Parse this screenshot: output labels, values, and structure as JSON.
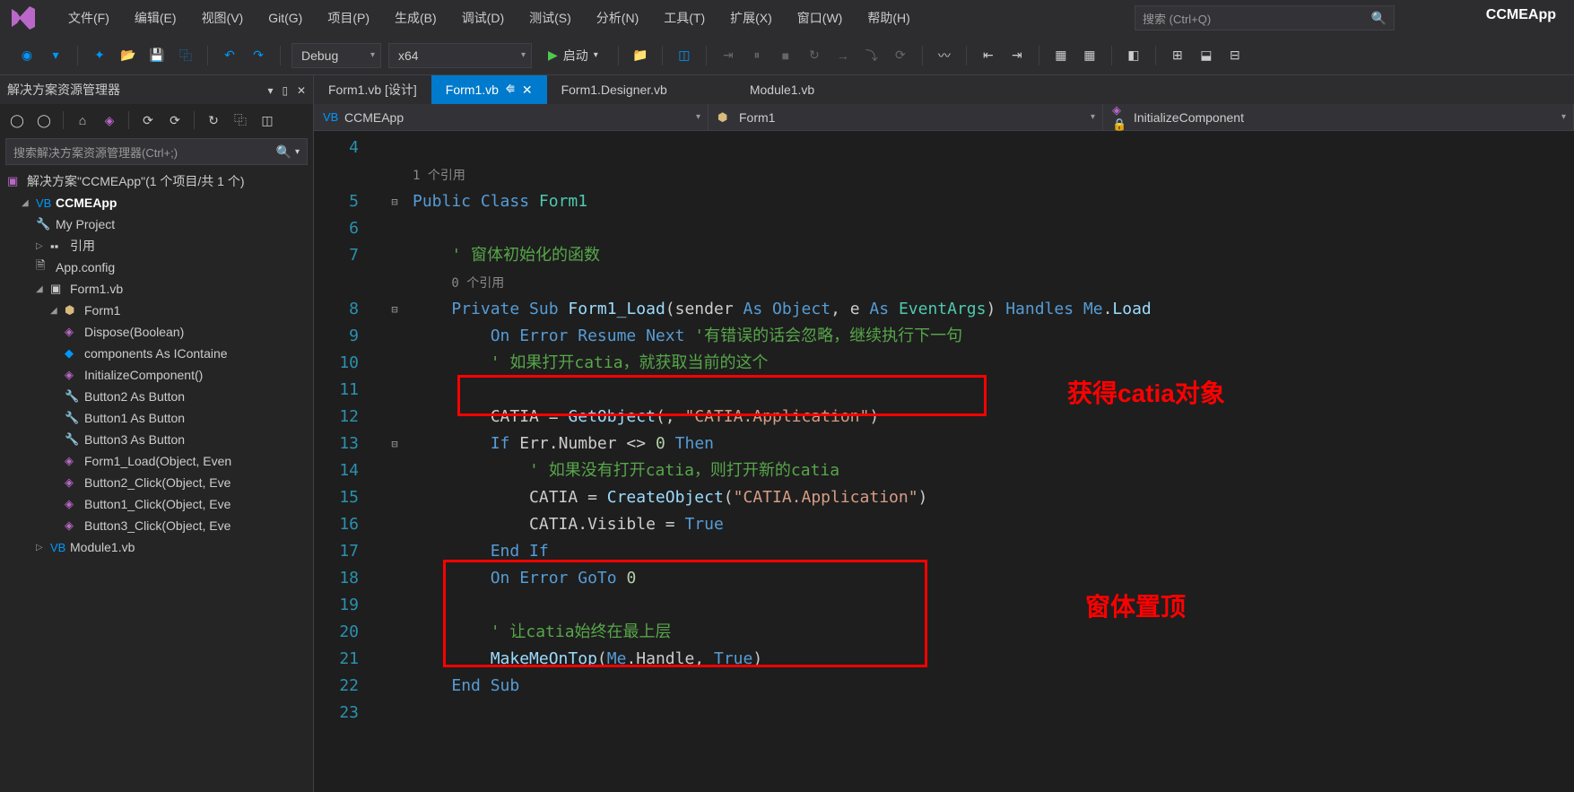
{
  "menu": {
    "items": [
      "文件(F)",
      "编辑(E)",
      "视图(V)",
      "Git(G)",
      "项目(P)",
      "生成(B)",
      "调试(D)",
      "测试(S)",
      "分析(N)",
      "工具(T)",
      "扩展(X)",
      "窗口(W)",
      "帮助(H)"
    ],
    "search_placeholder": "搜索 (Ctrl+Q)",
    "app_name": "CCMEApp"
  },
  "toolbar": {
    "config": "Debug",
    "platform": "x64",
    "start": "启动"
  },
  "solution_explorer": {
    "title": "解决方案资源管理器",
    "search_placeholder": "搜索解决方案资源管理器(Ctrl+;)",
    "root": "解决方案\"CCMEApp\"(1 个项目/共 1 个)",
    "project": "CCMEApp",
    "nodes": {
      "myproject": "My Project",
      "references": "引用",
      "appconfig": "App.config",
      "form1vb": "Form1.vb",
      "form1": "Form1",
      "dispose": "Dispose(Boolean)",
      "components": "components As IContaine",
      "initcomp": "InitializeComponent()",
      "btn2": "Button2 As Button",
      "btn1": "Button1 As Button",
      "btn3": "Button3 As Button",
      "form1load": "Form1_Load(Object, Even",
      "btn2click": "Button2_Click(Object, Eve",
      "btn1click": "Button1_Click(Object, Eve",
      "btn3click": "Button3_Click(Object, Eve",
      "module1": "Module1.vb"
    }
  },
  "tabs": {
    "design": "Form1.vb [设计]",
    "code": "Form1.vb",
    "designer": "Form1.Designer.vb",
    "module": "Module1.vb"
  },
  "nav": {
    "project": "CCMEApp",
    "class": "Form1",
    "method": "InitializeComponent"
  },
  "code": {
    "line_numbers": [
      "4",
      "",
      "5",
      "6",
      "7",
      "",
      "8",
      "9",
      "10",
      "11",
      "12",
      "13",
      "14",
      "15",
      "16",
      "17",
      "18",
      "19",
      "20",
      "21",
      "22",
      "23"
    ],
    "ref1": "1 个引用",
    "ref0": "0 个引用",
    "class_decl_kw": "Public Class",
    "class_name": "Form1",
    "cmt_init": "' 窗体初始化的函数",
    "sub_kw": "Private Sub",
    "sub_name": "Form1_Load",
    "params": "(sender As Object, e As EventArgs)",
    "handles": "Handles Me.Load",
    "on_error": "On Error Resume Next",
    "cmt_err": "'有错误的话会忽略，继续执行下一句",
    "cmt_ifopen": "' 如果打开catia，就获取当前的这个",
    "getobj": "CATIA = GetObject(, \"CATIA.Application\")",
    "if_line": "If Err.Number <> 0 Then",
    "cmt_notopen": "' 如果没有打开catia，则打开新的catia",
    "createobj": "CATIA = CreateObject(\"CATIA.Application\")",
    "visible": "CATIA.Visible = True",
    "endif": "End If",
    "on_error_goto": "On Error GoTo 0",
    "cmt_top": "' 让catia始终在最上层",
    "maketop": "MakeMeOnTop(Me.Handle, True)",
    "endsub": "End Sub"
  },
  "annotations": {
    "label1": "获得catia对象",
    "label2": "窗体置顶"
  }
}
